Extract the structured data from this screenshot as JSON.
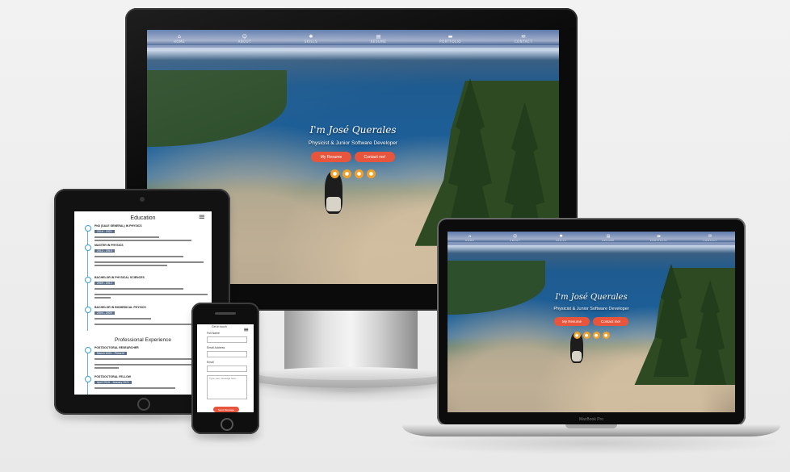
{
  "site": {
    "hero_title": "I'm José Querales",
    "hero_subtitle": "Physicist & Junior Software Developer",
    "buttons": {
      "resume": "My Resume",
      "contact": "Contact me!"
    },
    "nav": [
      {
        "icon": "home-icon",
        "glyph": "⌂",
        "label": "HOME"
      },
      {
        "icon": "user-icon",
        "glyph": "☺",
        "label": "ABOUT"
      },
      {
        "icon": "cogs-icon",
        "glyph": "✱",
        "label": "SKILLS"
      },
      {
        "icon": "file-icon",
        "glyph": "▤",
        "label": "RESUME"
      },
      {
        "icon": "folder-icon",
        "glyph": "▬",
        "label": "PORTFOLIO"
      },
      {
        "icon": "envelope-icon",
        "glyph": "✉",
        "label": "CONTACT"
      }
    ],
    "social_icons": [
      "github-icon",
      "linkedin-icon",
      "file-icon",
      "email-icon"
    ]
  },
  "tablet": {
    "section_education": "Education",
    "section_experience": "Professional Experience",
    "education": [
      {
        "head": "PhD (SALE GENERAL) IN PHYSICS",
        "date": "2016 - 2021"
      },
      {
        "head": "MASTER IN PHYSICS",
        "date": "2012 - 2015"
      },
      {
        "head": "BACHELOR IN PHYSICAL SCIENCES",
        "date": "2009 - 2012"
      },
      {
        "head": "BACHELOR IN BIOMEDICAL PHYSICS",
        "date": "2004 - 2009"
      }
    ],
    "experience": [
      {
        "head": "POSTDOCTORAL RESEARCHER",
        "date": "March 2021 - Present"
      },
      {
        "head": "POSTDOCTORAL FELLOW",
        "date": "April 2018 - January 2021"
      }
    ]
  },
  "phone": {
    "header": "Get in touch",
    "fields": [
      "Full Name",
      "Email Address",
      "Email"
    ],
    "message_placeholder": "Type your message here...",
    "submit": "Send Message"
  },
  "laptop_brand": "MacBook Pro"
}
